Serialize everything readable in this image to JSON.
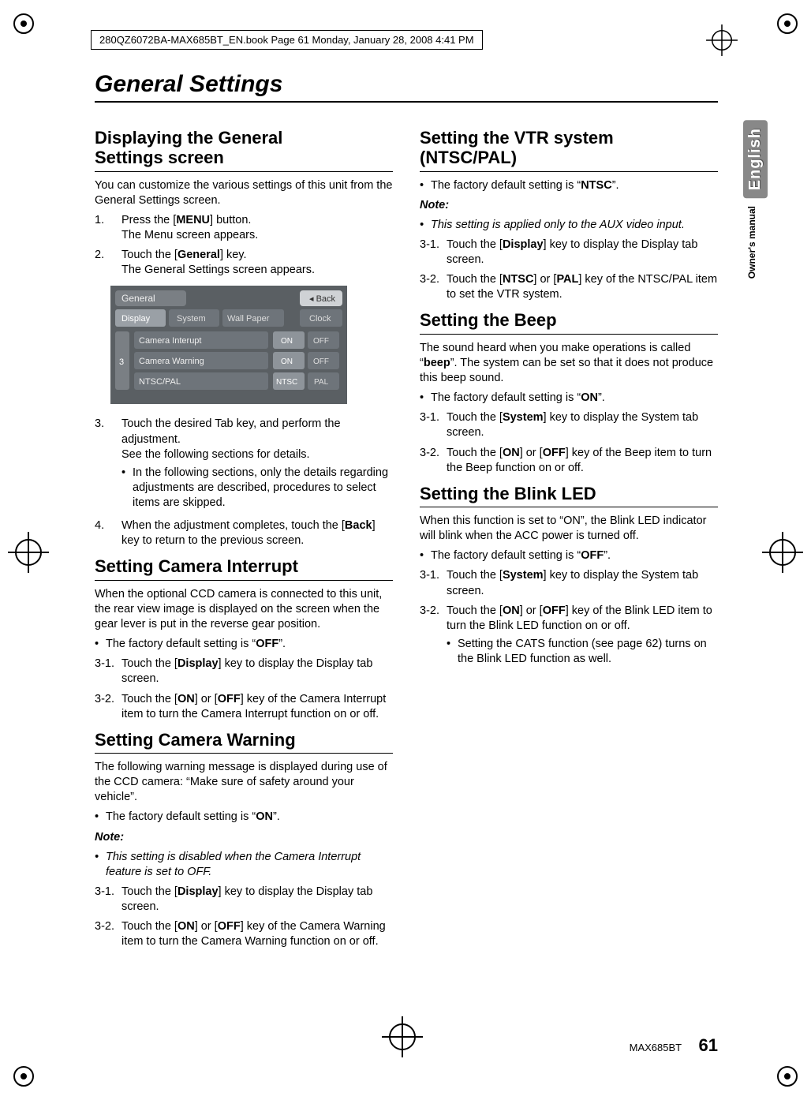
{
  "header": {
    "filestamp": "280QZ6072BA-MAX685BT_EN.book  Page 61  Monday, January 28, 2008  4:41 PM"
  },
  "chapter_title": "General Settings",
  "side": {
    "language": "English",
    "owners": "Owner's manual"
  },
  "footer": {
    "model": "MAX685BT",
    "page": "61"
  },
  "left": {
    "sec1_title_a": "Displaying the General",
    "sec1_title_b": "Settings screen",
    "sec1_intro": "You can customize the various settings of this unit from the General Settings screen.",
    "s1_step1a": "Press the [",
    "s1_step1b": "MENU",
    "s1_step1c": "] button.",
    "s1_step1_sub": "The Menu screen appears.",
    "s1_step2a": "Touch the [",
    "s1_step2b": "General",
    "s1_step2c": "] key.",
    "s1_step2_sub": "The General Settings screen appears.",
    "s1_step3": "Touch the desired Tab key, and perform the adjustment.",
    "s1_step3_sub1": "See the following sections for details.",
    "s1_step3_sub2": "In the following sections, only the details regarding adjustments are described, procedures to select items are skipped.",
    "s1_step4a": "When the adjustment completes, touch the [",
    "s1_step4b": "Back",
    "s1_step4c": "] key to return to the previous screen.",
    "sec2_title": "Setting Camera Interrupt",
    "sec2_p1": "When the optional CCD camera is connected to this unit, the rear view image is displayed on the screen when the gear lever is put in the reverse gear position.",
    "sec2_def": "The factory default setting is “OFF”.",
    "sec2_s31a": "Touch the [",
    "sec2_s31b": "Display",
    "sec2_s31c": "] key to display the Display tab screen.",
    "sec2_s32a": "Touch the [",
    "sec2_s32b": "ON",
    "sec2_s32c": "] or [",
    "sec2_s32d": "OFF",
    "sec2_s32e": "] key of the Camera Interrupt item to turn the Camera Interrupt function on or off.",
    "sec3_title": "Setting Camera Warning",
    "sec3_p1": "The following warning message is displayed during use of the CCD camera: “Make sure of safety around your vehicle”.",
    "sec3_def": "The factory default setting is “ON”.",
    "sec3_note_t": "Note:",
    "sec3_note_b": "This setting is disabled when the Camera Interrupt feature is set to OFF.",
    "sec3_s31a": "Touch the [",
    "sec3_s31b": "Display",
    "sec3_s31c": "] key to display the Display tab screen.",
    "sec3_s32a": "Touch the [",
    "sec3_s32b": "ON",
    "sec3_s32c": "] or [",
    "sec3_s32d": "OFF",
    "sec3_s32e": "] key of the Camera Warning item to turn the Camera Warning function on or off."
  },
  "right": {
    "sec4_title_a": "Setting the VTR system",
    "sec4_title_b": "(NTSC/PAL)",
    "sec4_def": "The factory default setting is “NTSC”.",
    "sec4_note_t": "Note:",
    "sec4_note_b": "This setting is applied only to the AUX video input.",
    "sec4_s31a": "Touch the [",
    "sec4_s31b": "Display",
    "sec4_s31c": "] key to display the Display tab screen.",
    "sec4_s32a": "Touch the [",
    "sec4_s32b": "NTSC",
    "sec4_s32c": "] or [",
    "sec4_s32d": "PAL",
    "sec4_s32e": "] key of the NTSC/PAL item to set the VTR system.",
    "sec5_title": "Setting the Beep",
    "sec5_p1a": "The sound heard when you make operations is called “",
    "sec5_p1b": "beep",
    "sec5_p1c": "”. The system can be set so that it does not produce this beep sound.",
    "sec5_def": "The factory default setting is “ON”.",
    "sec5_s31a": "Touch the [",
    "sec5_s31b": "System",
    "sec5_s31c": "] key to display the System tab screen.",
    "sec5_s32a": "Touch the [",
    "sec5_s32b": "ON",
    "sec5_s32c": "] or [",
    "sec5_s32d": "OFF",
    "sec5_s32e": "] key of the Beep item to turn the Beep function on or off.",
    "sec6_title": "Setting the Blink LED",
    "sec6_p1": "When this function is set to “ON”, the Blink LED indicator will blink when the ACC power is turned off.",
    "sec6_def": "The factory default setting is “OFF”.",
    "sec6_s31a": "Touch the [",
    "sec6_s31b": "System",
    "sec6_s31c": "] key to display the System tab screen.",
    "sec6_s32a": "Touch the [",
    "sec6_s32b": "ON",
    "sec6_s32c": "] or [",
    "sec6_s32d": "OFF",
    "sec6_s32e": "] key of the Blink LED item to turn the Blink LED function on or off.",
    "sec6_s32_sub": "Setting the CATS function (see page 62) turns on the Blink LED function as well."
  },
  "ui": {
    "title": "General",
    "back": "Back",
    "tabs": [
      "Display",
      "System",
      "Wall Paper",
      "Clock"
    ],
    "rows": [
      {
        "label": "Camera Interupt",
        "a": "ON",
        "b": "OFF"
      },
      {
        "label": "Camera Warning",
        "a": "ON",
        "b": "OFF"
      },
      {
        "label": "NTSC/PAL",
        "a": "NTSC",
        "b": "PAL"
      }
    ],
    "pager": "3"
  }
}
